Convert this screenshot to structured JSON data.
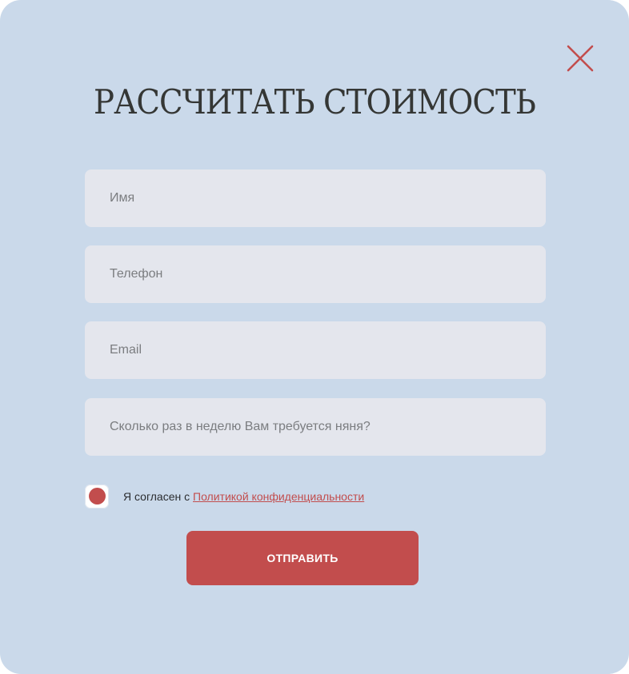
{
  "modal": {
    "title": "РАССЧИТАТЬ СТОИМОСТЬ",
    "close_icon": "close-icon"
  },
  "form": {
    "name_placeholder": "Имя",
    "phone_placeholder": "Телефон",
    "email_placeholder": "Email",
    "frequency_placeholder": "Сколько раз в неделю Вам требуется няня?",
    "consent_text": "Я согласен с ",
    "consent_link": "Политикой конфиденциальности",
    "consent_checked": true,
    "submit_label": "ОТПРАВИТЬ"
  },
  "colors": {
    "background": "#cad9ea",
    "accent": "#c24d4d",
    "field_bg": "#e4e6ed",
    "title": "#353735"
  }
}
